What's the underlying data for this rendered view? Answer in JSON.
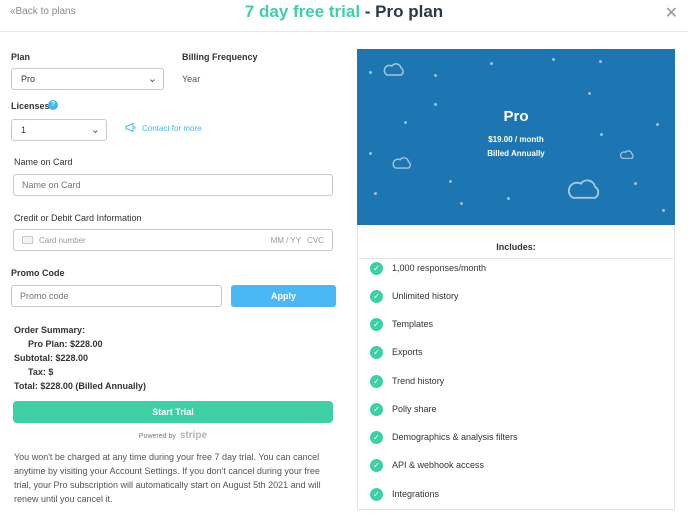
{
  "header": {
    "back_label": "«Back to plans",
    "title_accent": "7 day free trial",
    "title_rest": " - Pro plan",
    "close_label": "✕"
  },
  "form": {
    "plan_label": "Plan",
    "plan_value": "Pro",
    "billing_label": "Billing Frequency",
    "billing_value": "Year",
    "licenses_label": "Licenses",
    "licenses_help": "?",
    "licenses_value": "1",
    "contact_label": "Contact for more",
    "name_label": "Name on Card",
    "name_placeholder": "Name on Card",
    "card_label": "Credit or Debit Card Information",
    "card_number_placeholder": "Card number",
    "card_expiry_placeholder": "MM / YY",
    "card_cvc_placeholder": "CVC",
    "promo_label": "Promo Code",
    "promo_placeholder": "Promo code",
    "apply_label": "Apply"
  },
  "summary": {
    "title": "Order Summary:",
    "plan_line": "Pro Plan: $228.00",
    "subtotal_line": "Subtotal: $228.00",
    "tax_line": "Tax: $",
    "total_line": "Total: $228.00 (Billed Annually)"
  },
  "actions": {
    "start_label": "Start Trial",
    "powered_by": "Powered by",
    "stripe": "stripe"
  },
  "disclaimer": "You won't be charged at any time during your free 7 day trial. You can cancel anytime by visiting your Account Settings. If you don't cancel during your free trial, your Pro subscription will automatically start on August 5th 2021 and will renew until you cancel it.",
  "plan_card": {
    "name": "Pro",
    "price": "$19.00 / month",
    "billing": "Billed Annually",
    "background_color": "#1d76b1"
  },
  "includes": {
    "title": "Includes:",
    "features": [
      "1,000 responses/month",
      "Unlimited history",
      "Templates",
      "Exports",
      "Trend history",
      "Polly share",
      "Demographics & analysis filters",
      "API & webhook access",
      "Integrations"
    ]
  },
  "colors": {
    "accent_green": "#3ecfa6",
    "accent_blue": "#4ab8f3",
    "title_dark": "#2b3a42"
  }
}
